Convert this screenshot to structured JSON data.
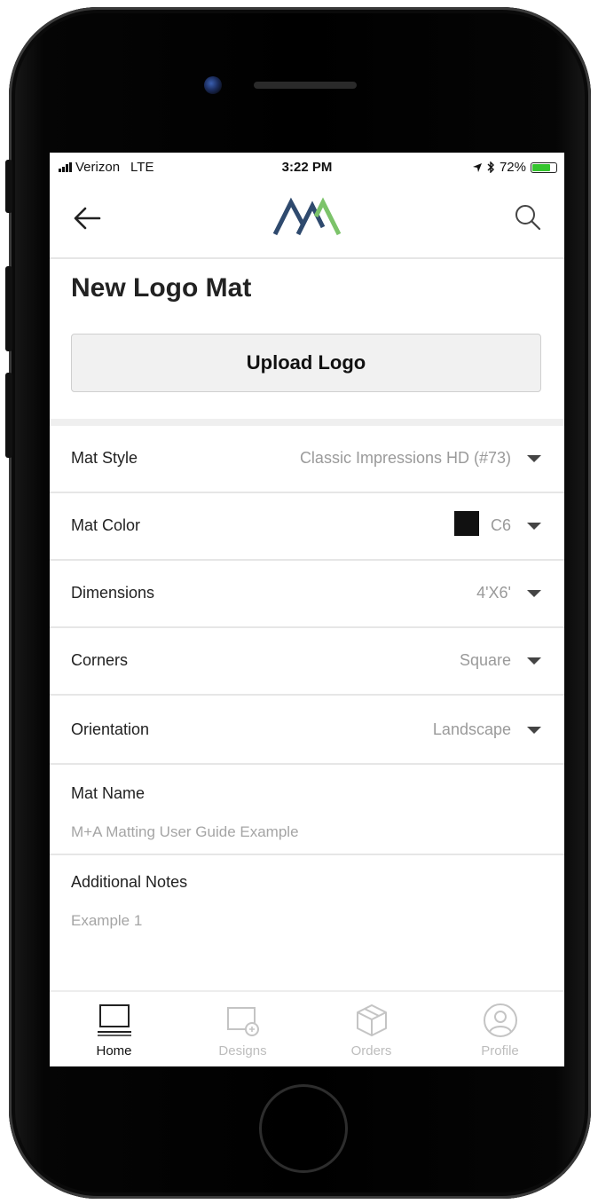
{
  "status_bar": {
    "carrier": "Verizon",
    "network": "LTE",
    "time": "3:22 PM",
    "battery": "72%",
    "battery_level": 0.72
  },
  "header": {
    "back_icon": "back-arrow-icon",
    "logo": "MA",
    "search_icon": "search-icon"
  },
  "page": {
    "title": "New Logo Mat",
    "upload_button": "Upload Logo"
  },
  "options": [
    {
      "label": "Mat Style",
      "value": "Classic Impressions HD (#73)"
    },
    {
      "label": "Mat Color",
      "value": "C6",
      "swatch": "#111111"
    },
    {
      "label": "Dimensions",
      "value": "4'X6'"
    },
    {
      "label": "Corners",
      "value": "Square"
    },
    {
      "label": "Orientation",
      "value": "Landscape"
    }
  ],
  "fields": {
    "mat_name": {
      "label": "Mat Name",
      "value": "M+A Matting User Guide Example"
    },
    "notes": {
      "label": "Additional Notes",
      "value": "Example 1"
    }
  },
  "tabs": [
    {
      "label": "Home",
      "icon": "laptop-icon",
      "active": true
    },
    {
      "label": "Designs",
      "icon": "designs-icon",
      "active": false
    },
    {
      "label": "Orders",
      "icon": "box-icon",
      "active": false
    },
    {
      "label": "Profile",
      "icon": "profile-icon",
      "active": false
    }
  ],
  "colors": {
    "logo_blue": "#2f4a6e",
    "logo_green": "#7cc36a",
    "battery_green": "#35c52e"
  }
}
